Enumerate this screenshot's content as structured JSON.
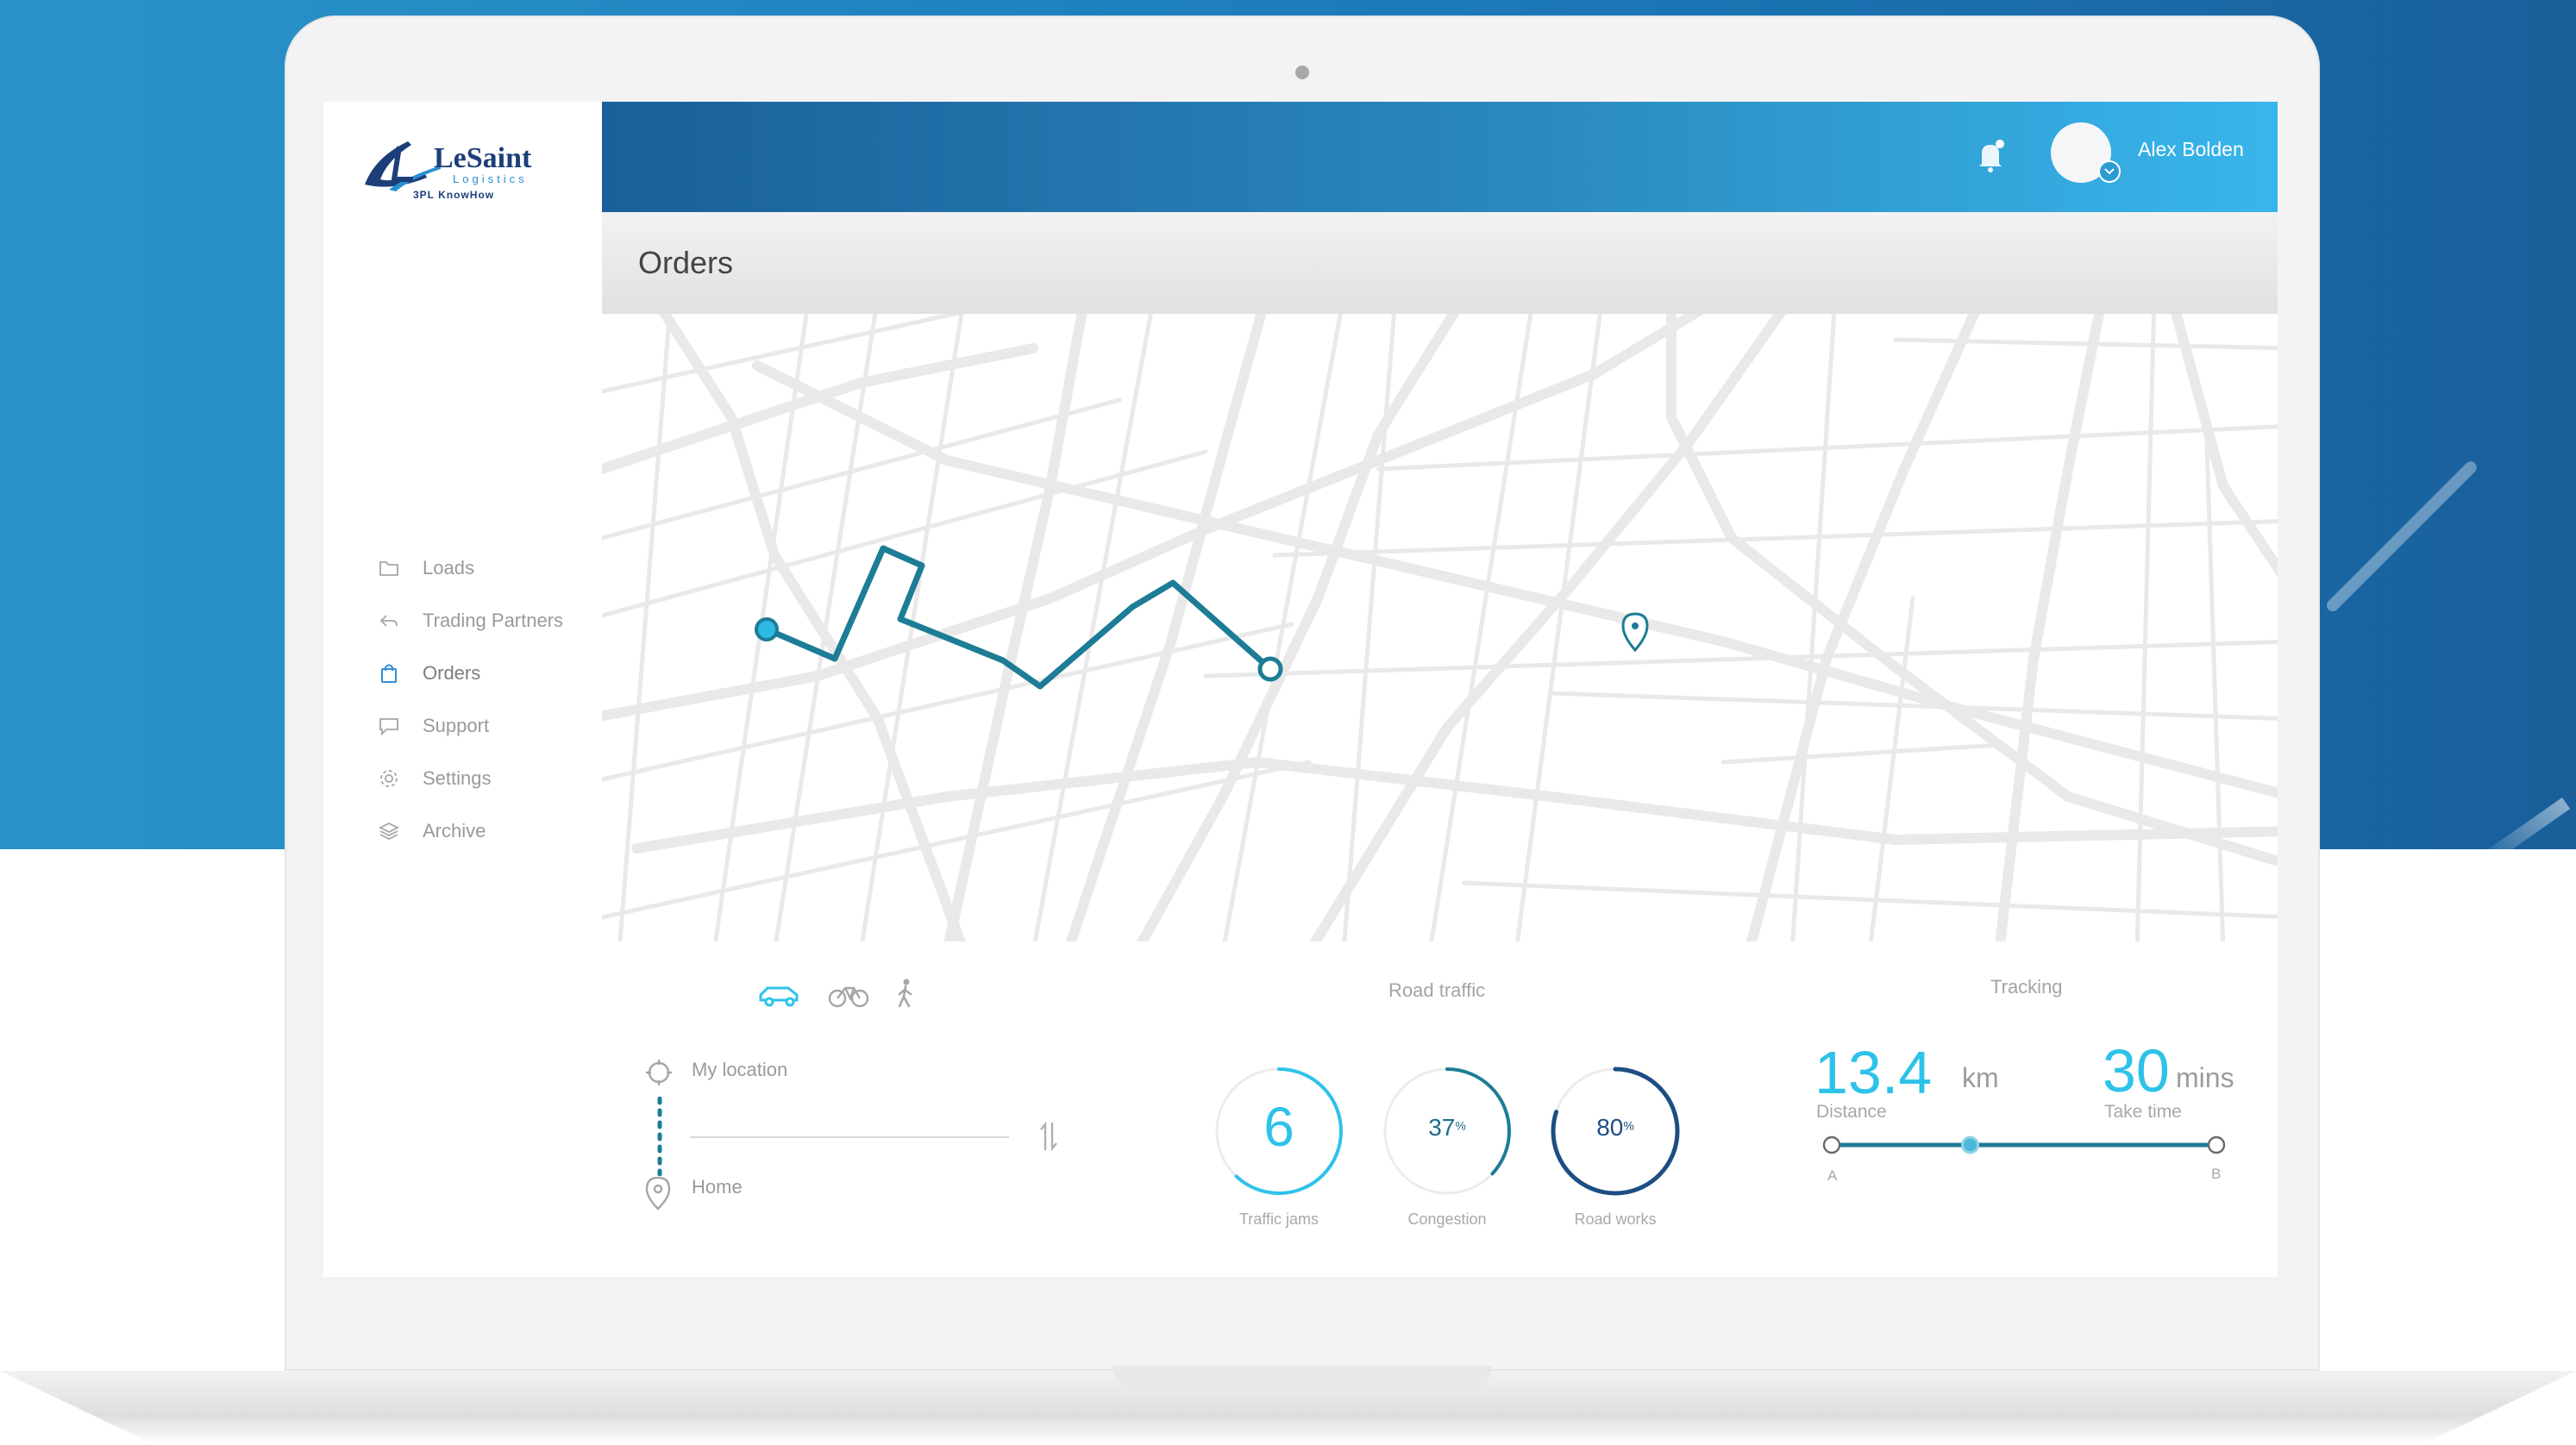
{
  "brand": {
    "logo_name": "LeSaint",
    "logo_subtitle": "Logistics",
    "logo_tagline": "3PL KnowHow"
  },
  "header": {
    "user_name": "Alex Bolden"
  },
  "sidebar": {
    "items": [
      {
        "label": "Loads",
        "icon": "folder-icon",
        "active": false
      },
      {
        "label": "Trading Partners",
        "icon": "reply-arrow-icon",
        "active": false
      },
      {
        "label": "Orders",
        "icon": "shopping-bag-icon",
        "active": true
      },
      {
        "label": "Support",
        "icon": "chat-bubble-icon",
        "active": false
      },
      {
        "label": "Settings",
        "icon": "gear-icon",
        "active": false
      },
      {
        "label": "Archive",
        "icon": "layers-icon",
        "active": false
      }
    ]
  },
  "page": {
    "title": "Orders"
  },
  "route_panel": {
    "modes": [
      {
        "icon": "car-icon",
        "active": true
      },
      {
        "icon": "bicycle-icon",
        "active": false
      },
      {
        "icon": "walking-icon",
        "active": false
      }
    ],
    "from_label": "My location",
    "to_label": "Home"
  },
  "road_traffic": {
    "title": "Road traffic",
    "gauges": [
      {
        "value": "6",
        "unit": "",
        "label": "Traffic jams",
        "fraction": 0.62
      },
      {
        "value": "37",
        "unit": "%",
        "label": "Congestion",
        "fraction": 0.37
      },
      {
        "value": "80",
        "unit": "%",
        "label": "Road works",
        "fraction": 0.8
      }
    ]
  },
  "tracking": {
    "title": "Tracking",
    "distance_value": "13.4",
    "distance_unit": "km",
    "distance_label": "Distance",
    "time_value": "30",
    "time_unit": "mins",
    "time_label": "Take time",
    "start_label": "A",
    "end_label": "B",
    "progress": 0.36
  },
  "colors": {
    "accent": "#2ec2ea",
    "route": "#1d7c96",
    "header_start": "#1a5f9a",
    "header_end": "#38b6ec",
    "gauge_dark": "#1c4e83"
  }
}
